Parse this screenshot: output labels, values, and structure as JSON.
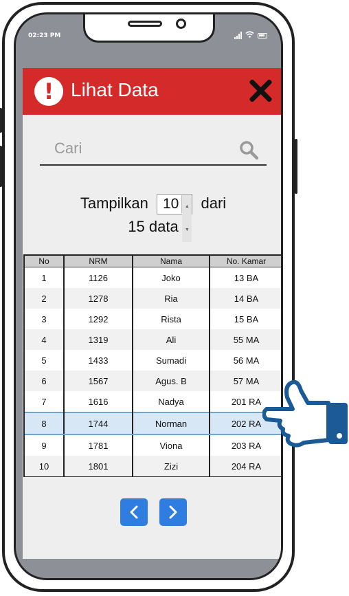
{
  "status_bar": {
    "time": "02:23 PM"
  },
  "header": {
    "title": "Lihat Data",
    "alert_icon": "!"
  },
  "search": {
    "placeholder": "Cari"
  },
  "paging": {
    "show_label": "Tampilkan",
    "page_size": "10",
    "of_label": "dari",
    "total_label": "15 data"
  },
  "table": {
    "columns": [
      "No",
      "NRM",
      "Nama",
      "No. Kamar"
    ],
    "rows": [
      [
        "1",
        "1126",
        "Joko",
        "13 BA"
      ],
      [
        "2",
        "1278",
        "Ria",
        "14 BA"
      ],
      [
        "3",
        "1292",
        "Rista",
        "15 BA"
      ],
      [
        "4",
        "1319",
        "Ali",
        "55 MA"
      ],
      [
        "5",
        "1433",
        "Sumadi",
        "56 MA"
      ],
      [
        "6",
        "1567",
        "Agus. B",
        "57 MA"
      ],
      [
        "7",
        "1616",
        "Nadya",
        "201 RA"
      ],
      [
        "8",
        "1744",
        "Norman",
        "202 RA"
      ],
      [
        "9",
        "1781",
        "Viona",
        "203 RA"
      ],
      [
        "10",
        "1801",
        "Zizi",
        "204 RA"
      ]
    ],
    "selected_row": 8
  },
  "pagination": {
    "prev_icon": "chevron-left-icon",
    "next_icon": "chevron-right-icon"
  },
  "colors": {
    "header": "#d42a2a",
    "accent": "#2f7de0",
    "selection": "#d8e7f6",
    "pointer": "#1c5a96"
  }
}
